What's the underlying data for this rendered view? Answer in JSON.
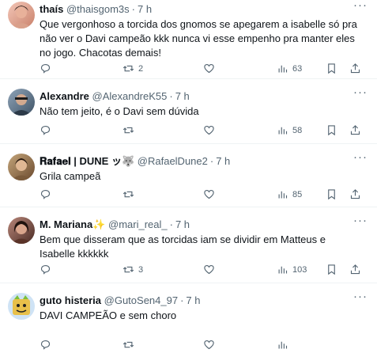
{
  "replies": [
    {
      "name": "thaís",
      "handle": "@thaisgom3s",
      "time": "7 h",
      "badge": "",
      "text": "Que vergonhoso a torcida dos gnomos se apegarem a isabelle só pra não ver o Davi campeão kkk nunca vi esse empenho pra manter eles no jogo. Chacotas demais!",
      "replies": "",
      "retweets": "2",
      "views": "63"
    },
    {
      "name": "Alexandre",
      "handle": "@AlexandreK55",
      "time": "7 h",
      "badge": "",
      "text": "Não tem jeito, é o Davi sem dúvida",
      "replies": "",
      "retweets": "",
      "views": "58"
    },
    {
      "name": "𝐑𝐚𝐟𝐚𝐞𝐥 | DUNE ッ🐺",
      "handle": "@RafaelDune2",
      "time": "7 h",
      "badge": "",
      "text": "Grila campeã",
      "replies": "",
      "retweets": "",
      "views": "85"
    },
    {
      "name": "M. Mariana",
      "handle": "@mari_real_",
      "time": "7 h",
      "badge": "✨",
      "text": "Bem que disseram que as torcidas iam se dividir em Matteus e Isabelle kkkkkk",
      "replies": "",
      "retweets": "3",
      "views": "103"
    },
    {
      "name": "guto histeria",
      "handle": "@GutoSen4_97",
      "time": "7 h",
      "badge": "",
      "text": "DAVI CAMPEÃO e sem choro",
      "replies": "",
      "retweets": "",
      "views": ""
    }
  ],
  "icons": {
    "reply": "reply-icon",
    "retweet": "retweet-icon",
    "like": "like-icon",
    "views": "views-icon",
    "bookmark": "bookmark-icon",
    "share": "share-icon"
  },
  "colors": {
    "text": "#0f1419",
    "secondary": "#536471",
    "divider": "#eff3f4"
  }
}
